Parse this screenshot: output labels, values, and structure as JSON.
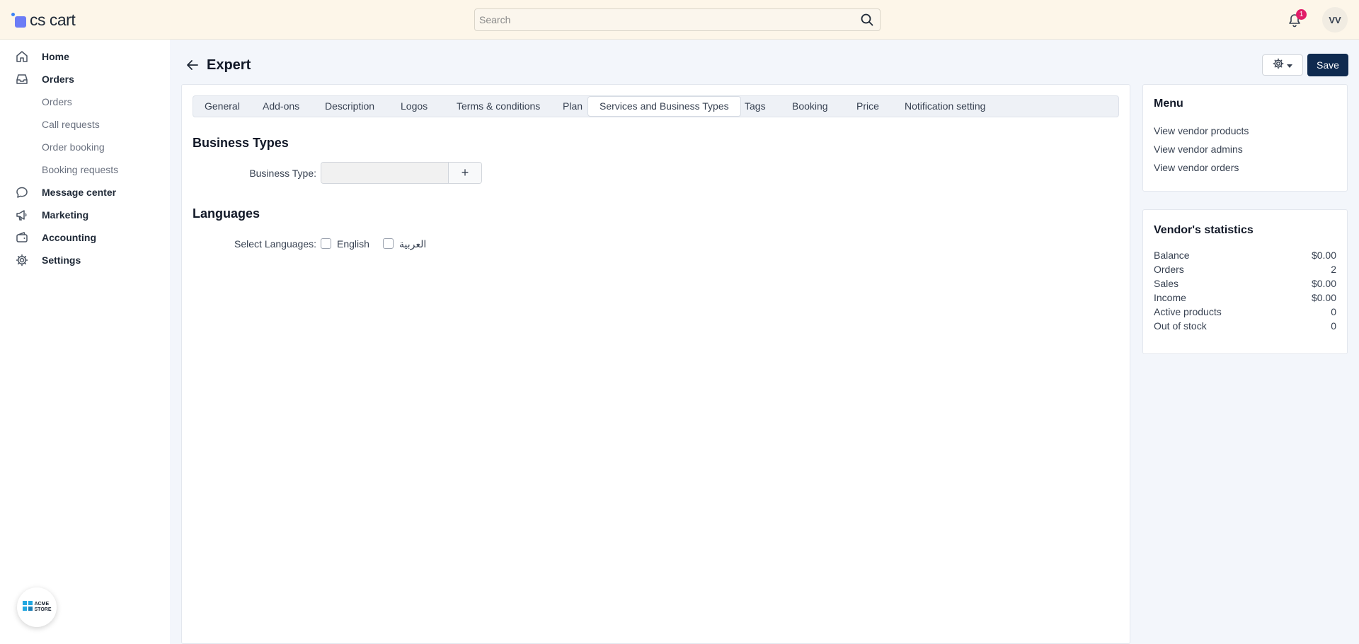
{
  "header": {
    "logo_text": "cs cart",
    "search_placeholder": "Search",
    "notifications_count": "1",
    "user_initials": "VV"
  },
  "sidebar": {
    "items": [
      {
        "label": "Home",
        "icon": "home-icon"
      },
      {
        "label": "Orders",
        "icon": "inbox-icon"
      },
      {
        "label": "Message center",
        "icon": "chat-icon"
      },
      {
        "label": "Marketing",
        "icon": "megaphone-icon"
      },
      {
        "label": "Accounting",
        "icon": "wallet-icon"
      },
      {
        "label": "Settings",
        "icon": "gear-icon"
      }
    ],
    "orders_sub": [
      "Orders",
      "Call requests",
      "Order booking",
      "Booking requests"
    ],
    "store_badge": {
      "line1": "ACME",
      "line2": "STORE"
    }
  },
  "page": {
    "title": "Expert",
    "save_label": "Save"
  },
  "tabs": [
    "General",
    "Add-ons",
    "Description",
    "Logos",
    "Terms & conditions",
    "Plan",
    "Services and Business Types",
    "Tags",
    "Booking",
    "Price",
    "Notification setting"
  ],
  "active_tab": "Services and Business Types",
  "business_types": {
    "section_title": "Business Types",
    "field_label": "Business Type:",
    "value": "",
    "add_symbol": "+"
  },
  "languages": {
    "section_title": "Languages",
    "field_label": "Select Languages:",
    "options": [
      {
        "label": "English",
        "checked": false
      },
      {
        "label": "العربية",
        "checked": false
      }
    ]
  },
  "menu_panel": {
    "title": "Menu",
    "links": [
      "View vendor products",
      "View vendor admins",
      "View vendor orders"
    ]
  },
  "stats_panel": {
    "title": "Vendor's statistics",
    "rows": [
      {
        "label": "Balance",
        "value": "$0.00"
      },
      {
        "label": "Orders",
        "value": "2"
      },
      {
        "label": "Sales",
        "value": "$0.00"
      },
      {
        "label": "Income",
        "value": "$0.00"
      },
      {
        "label": "Active products",
        "value": "0"
      },
      {
        "label": "Out of stock",
        "value": "0"
      }
    ]
  },
  "colors": {
    "topbar_bg": "#fdf6e9",
    "save_button": "#0f2a4f",
    "badge": "#e11d68",
    "logo_accent": "#6b7cf6"
  }
}
